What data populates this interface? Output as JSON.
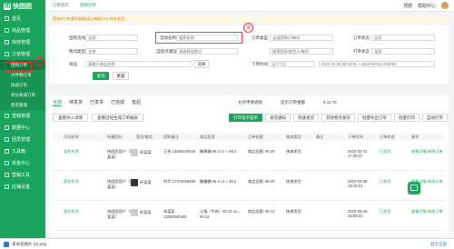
{
  "sidebar": {
    "brand": "快团团",
    "items": [
      {
        "label": "首页"
      },
      {
        "label": "商品管理"
      },
      {
        "label": "库存管理"
      },
      {
        "label": "订单管理"
      }
    ],
    "sub": [
      {
        "label": "团购订单"
      },
      {
        "label": "大件物订单"
      },
      {
        "label": "快递订单"
      },
      {
        "label": "积分商城订单"
      },
      {
        "label": "售后管理"
      }
    ],
    "bottom": [
      {
        "label": "营销管理"
      },
      {
        "label": "数据中心"
      },
      {
        "label": "团员管理"
      },
      {
        "label": "工具箱"
      },
      {
        "label": "资金中心"
      },
      {
        "label": "营销工具"
      },
      {
        "label": "店铺设置"
      }
    ],
    "mark1": "①"
  },
  "topbar": {
    "tabs": [
      "订单首页",
      "团购订单"
    ],
    "right1": "顶部",
    "right2": "帮助中心"
  },
  "notice": "您有8个快递/同城配送订单超72小时未发货",
  "filter": {
    "row1": [
      {
        "label": "团购活动",
        "value": "全部"
      },
      {
        "label": "活动名称",
        "value": "搜索名称"
      },
      {
        "label": "订单类型",
        "value": "全部团购订单(8)"
      },
      {
        "label": "订单状态",
        "value": "全部"
      }
    ],
    "row2": [
      {
        "label": "物流类型",
        "value": "全部"
      },
      {
        "label": "自提点/配送员",
        "value": "请选择自提点"
      },
      {
        "label": "",
        "value": "搜索团员/收货人/电话"
      },
      {
        "label": "打单状态",
        "value": "全部"
      }
    ],
    "row3": {
      "label": "商品",
      "value": "请输入商品名称",
      "btn": "选择",
      "time_label": "下单时间",
      "time_value": "近7个月",
      "range": "2022-01-06 20:00:01 ~ 2022-04-06 23:59:59"
    },
    "mark2": "②",
    "query": "查询",
    "reset": "重置"
  },
  "tabs": {
    "items": [
      "全部",
      "待发货",
      "已发货",
      "已完成",
      "售后"
    ],
    "toggle1": "允许申请退款",
    "toggle2": "显示订单金额",
    "count_label": "¥.11.78"
  },
  "actions_left": [
    "查看导入详情",
    "查看已经生成订单报表"
  ],
  "actions_right": [
    "打印电子面单",
    "发货通知",
    "快速发货",
    "其他物流发货",
    "批量导出订单",
    "批量打印",
    "自动打单"
  ],
  "table": {
    "headers": [
      "活动名称",
      "所属团长",
      "团员/电话",
      "团购备注",
      "商品信息",
      "订单金额",
      "物流类型",
      "备注",
      "下单时间",
      "订单状态",
      "操作"
    ],
    "rows": [
      {
        "activity": "某些东西",
        "leader": "快团团用户（杯某某）",
        "member": "杯某某",
        "phone": "王伟 13260240443",
        "goods": "糖果糖 ¥0.2 x1 = ¥0.2",
        "amount": "商品金额: ¥0.20",
        "shipping": "快递发货",
        "time": "2022-03-31 17:26:07",
        "status": "已发货",
        "ops": "查看详情 修改订单"
      },
      {
        "activity": "某些东西",
        "leader": "快团团用户（杯某某）",
        "member": "杯某某",
        "phone": "何华 17701025485",
        "goods": "糖糖糖 ¥0.2 x1 = ¥0.2",
        "amount": "商品金额: ¥0.20",
        "shipping": "快递发货",
        "time": "2022-03-29 19:15:21",
        "status": "已发货",
        "ops": "查看详情 修改订单"
      },
      {
        "activity": "某些东西",
        "leader": "快团团用户（杯某某）",
        "member": "杯某某",
        "phone": "林某某 13260240443",
        "goods": "火锅（牛肉）¥0.12 x1 = ¥0.12",
        "amount": "商品金额: ¥0.12",
        "shipping": "快递发货",
        "time": "2022-03-29 19:05:21",
        "status": "已发货",
        "ops": "查看详情 修改订单"
      }
    ]
  },
  "download": {
    "file": "未命名图片 (2).png",
    "show_all": "显示全部"
  },
  "colors": {
    "brand": "#1aa35a",
    "accent_red": "#e33",
    "warning": "#c87a00"
  }
}
